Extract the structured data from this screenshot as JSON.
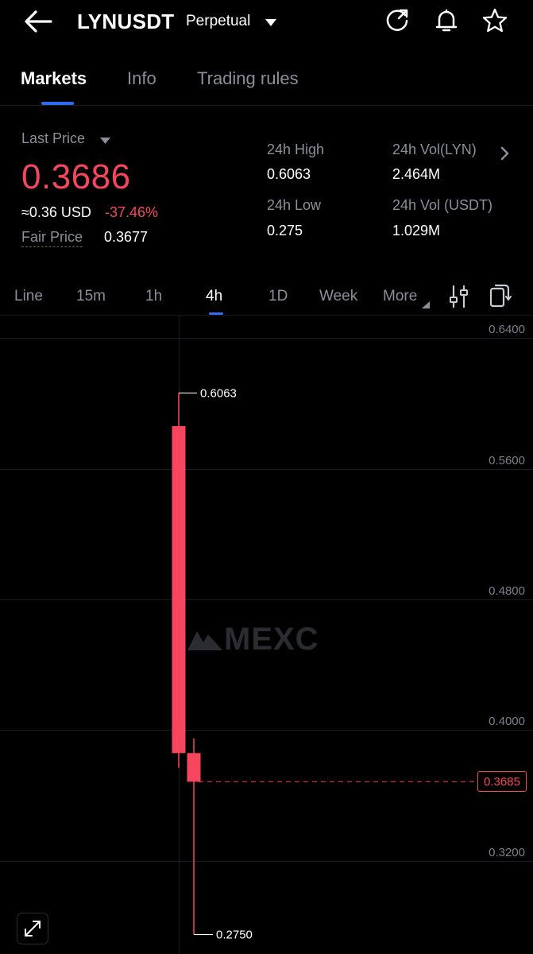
{
  "header": {
    "title": "LYNUSDT",
    "subtitle": "Perpetual",
    "icons": [
      "back-arrow-icon",
      "share-refresh-icon",
      "bell-icon",
      "star-icon"
    ]
  },
  "tabs": [
    {
      "label": "Markets",
      "active": true
    },
    {
      "label": "Info",
      "active": false
    },
    {
      "label": "Trading rules",
      "active": false
    }
  ],
  "price": {
    "last_label": "Last Price",
    "last_value": "0.3686",
    "usd_value": "≈0.36 USD",
    "change": "-37.46%",
    "fair_label": "Fair Price",
    "fair_value": "0.3677"
  },
  "stats": {
    "high_label": "24h High",
    "high_value": "0.6063",
    "low_label": "24h Low",
    "low_value": "0.275",
    "vol_lyn_label": "24h Vol(LYN)",
    "vol_lyn_value": "2.464M",
    "vol_usdt_label": "24h Vol (USDT)",
    "vol_usdt_value": "1.029M"
  },
  "intervals": [
    {
      "label": "Line",
      "active": false
    },
    {
      "label": "15m",
      "active": false
    },
    {
      "label": "1h",
      "active": false
    },
    {
      "label": "4h",
      "active": true
    },
    {
      "label": "1D",
      "active": false
    },
    {
      "label": "Week",
      "active": false
    },
    {
      "label": "More",
      "active": false
    }
  ],
  "colors": {
    "accent": "#2f6cf6",
    "down": "#f6465d",
    "background": "#000000"
  },
  "chart_data": {
    "type": "candlestick",
    "y_axis_labels": [
      "0.6400",
      "0.5600",
      "0.4800",
      "0.4000",
      "0.3200"
    ],
    "y_ticks": [
      0.64,
      0.56,
      0.48,
      0.4,
      0.32
    ],
    "candles": [
      {
        "open": 0.586,
        "high": 0.6063,
        "low": 0.377,
        "close": 0.386
      },
      {
        "open": 0.386,
        "high": 0.395,
        "low": 0.275,
        "close": 0.3685
      }
    ],
    "high_marker": "0.6063",
    "low_marker": "0.2750",
    "current_price": "0.3685",
    "watermark": "MEXC"
  }
}
